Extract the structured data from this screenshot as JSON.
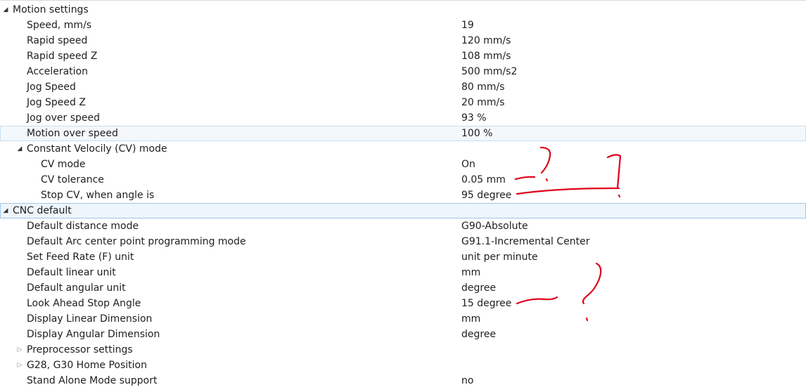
{
  "rows": [
    {
      "level": 0,
      "expander": "open",
      "name": "Motion settings",
      "value": ""
    },
    {
      "level": 1,
      "name": "Speed, mm/s",
      "value": "19"
    },
    {
      "level": 1,
      "name": "Rapid speed",
      "value": "120 mm/s"
    },
    {
      "level": 1,
      "name": "Rapid speed Z",
      "value": "108 mm/s"
    },
    {
      "level": 1,
      "name": "Acceleration",
      "value": "500 mm/s2"
    },
    {
      "level": 1,
      "name": "Jog Speed",
      "value": "80 mm/s"
    },
    {
      "level": 1,
      "name": "Jog Speed Z",
      "value": "20 mm/s"
    },
    {
      "level": 1,
      "name": "Jog over speed",
      "value": "93 %"
    },
    {
      "level": 1,
      "name": "Motion over speed",
      "value": "100 %",
      "selected": true
    },
    {
      "level": 1,
      "expander": "open",
      "name": "Constant Velocily (CV) mode",
      "value": ""
    },
    {
      "level": 2,
      "name": "CV mode",
      "value": "On"
    },
    {
      "level": 2,
      "name": "CV tolerance",
      "value": "0.05 mm"
    },
    {
      "level": 2,
      "name": "Stop CV, when angle is",
      "value": "95 degree"
    },
    {
      "level": 0,
      "expander": "open",
      "name": "CNC default",
      "value": "",
      "selected": true
    },
    {
      "level": 1,
      "name": "Default distance mode",
      "value": "G90-Absolute"
    },
    {
      "level": 1,
      "name": "Default Arc center point programming mode",
      "value": "G91.1-Incremental Center"
    },
    {
      "level": 1,
      "name": "Set Feed Rate (F) unit",
      "value": "unit per minute"
    },
    {
      "level": 1,
      "name": "Default linear unit",
      "value": "mm"
    },
    {
      "level": 1,
      "name": "Default angular unit",
      "value": "degree"
    },
    {
      "level": 1,
      "name": "Look Ahead Stop Angle",
      "value": "15 degree"
    },
    {
      "level": 1,
      "name": "Display Linear Dimension",
      "value": "mm"
    },
    {
      "level": 1,
      "name": "Display Angular Dimension",
      "value": "degree"
    },
    {
      "level": 1,
      "expander": "closed",
      "name": "Preprocessor settings",
      "value": ""
    },
    {
      "level": 1,
      "expander": "closed",
      "name": "G28, G30 Home Position",
      "value": ""
    },
    {
      "level": 1,
      "name": "Stand Alone Mode support",
      "value": "no"
    }
  ],
  "icons": {
    "expanded": "triangle-expanded-icon",
    "collapsed": "triangle-collapsed-icon"
  },
  "colors": {
    "annotation": "#e0001a",
    "selection_border": "#9ec7e8",
    "selection_fill": "#eef5fb"
  }
}
